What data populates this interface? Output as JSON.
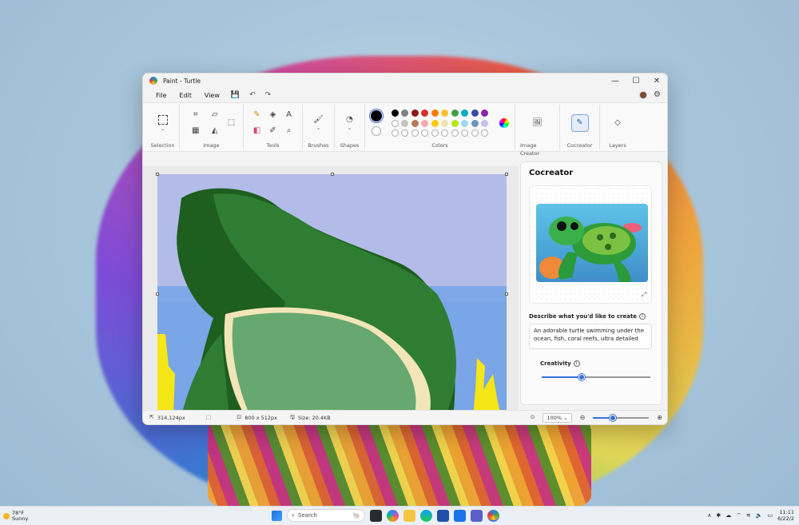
{
  "window": {
    "title": "Paint - Turtle",
    "controls": {
      "minimize": "—",
      "maximize": "☐",
      "close": "✕"
    }
  },
  "menu": {
    "file": "File",
    "edit": "Edit",
    "view": "View"
  },
  "ribbon": {
    "groups": {
      "selection": "Selection",
      "image": "Image",
      "tools": "Tools",
      "brushes": "Brushes",
      "shapes": "Shapes",
      "colors": "Colors",
      "image_creator": "Image Creator",
      "cocreator": "Cocreator",
      "layers": "Layers"
    },
    "palette_row1": [
      "#000000",
      "#7f7f7f",
      "#8b1a1a",
      "#d32f2f",
      "#f57c00",
      "#fbc02d",
      "#43a047",
      "#00acc1",
      "#3949ab",
      "#8e24aa"
    ],
    "palette_row2": [
      "#ffffff",
      "#c3c3c3",
      "#b97a57",
      "#f4a6b5",
      "#ffc90e",
      "#efe4b0",
      "#b5e61d",
      "#99d9ea",
      "#7092be",
      "#c8bfe7"
    ],
    "primary_color": "#000000",
    "secondary_color": "#ffffff"
  },
  "status": {
    "cursor": "314,124px",
    "dimensions": "800  x  512px",
    "size": "Size: 20.4KB",
    "zoom": "100%",
    "zoom_percent": 35
  },
  "cocreator_panel": {
    "title": "Cocreator",
    "describe_label": "Describe what you'd like to create",
    "prompt": "An adorable turtle swimming under the ocean, fish, coral reefs, ultra detailed",
    "creativity_label": "Creativity",
    "creativity_percent": 37
  },
  "taskbar": {
    "temperature": "78°F",
    "weather": "Sunny",
    "search_placeholder": "Search",
    "time": "11:11",
    "date": "6/22/2"
  },
  "colors": {
    "accent": "#3b6fd8"
  }
}
